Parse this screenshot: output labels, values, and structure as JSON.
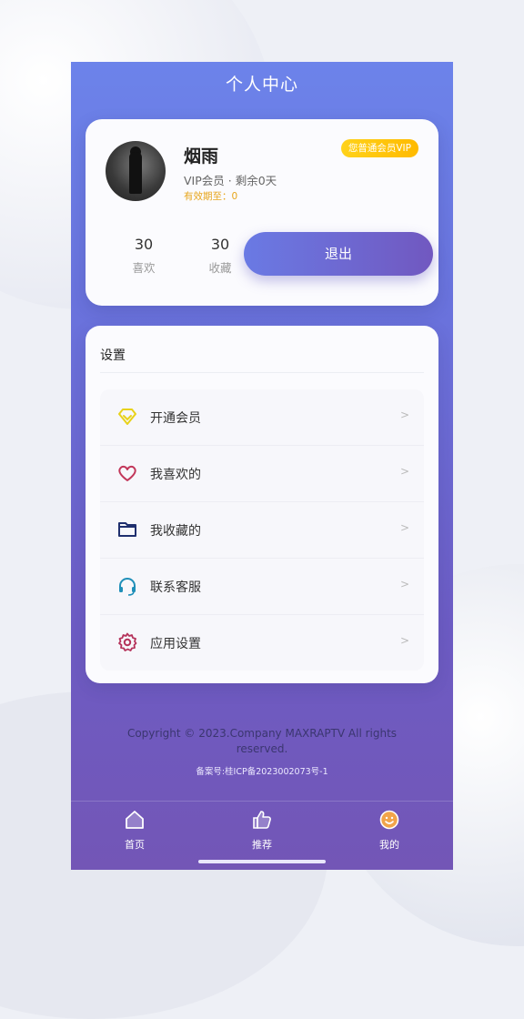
{
  "header": {
    "title": "个人中心"
  },
  "profile": {
    "name": "烟雨",
    "vip_status": "VIP会员 · 剩余0天",
    "valid_until": "有效期至：0",
    "badge": "您普通会员VIP",
    "stats": [
      {
        "value": "30",
        "label": "喜欢"
      },
      {
        "value": "30",
        "label": "收藏"
      }
    ],
    "logout_label": "退出"
  },
  "settings": {
    "title": "设置",
    "items": [
      {
        "label": "开通会员",
        "icon": "diamond-icon",
        "color": "#e8d21a",
        "arrow": ">"
      },
      {
        "label": "我喜欢的",
        "icon": "heart-icon",
        "color": "#c2375a",
        "arrow": ">"
      },
      {
        "label": "我收藏的",
        "icon": "folder-icon",
        "color": "#1f2f6e",
        "arrow": ">"
      },
      {
        "label": "联系客服",
        "icon": "headset-icon",
        "color": "#1f8fb8",
        "arrow": ">"
      },
      {
        "label": "应用设置",
        "icon": "gear-icon",
        "color": "#b5335b",
        "arrow": ">"
      }
    ]
  },
  "footer": {
    "copyright": "Copyright © 2023.Company MAXRAPTV All rights reserved.",
    "icp": "备案号:桂ICP备2023002073号-1"
  },
  "tabbar": {
    "tabs": [
      {
        "label": "首页",
        "icon": "home-icon"
      },
      {
        "label": "推荐",
        "icon": "thumbs-up-icon"
      },
      {
        "label": "我的",
        "icon": "smiley-icon"
      }
    ]
  },
  "colors": {
    "accent": "#6a73dd",
    "badge": "#ffc400"
  }
}
